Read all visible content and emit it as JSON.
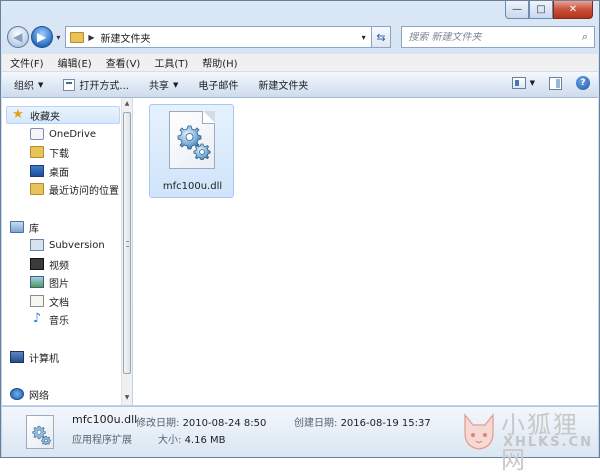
{
  "window": {
    "minimize_glyph": "—",
    "maximize_glyph": "□",
    "close_glyph": "✕"
  },
  "nav": {
    "back_glyph": "◀",
    "forward_glyph": "▶",
    "history_dd": "▾",
    "address_sep": "▶",
    "address_path": "新建文件夹",
    "address_dd": "▾",
    "refresh_glyph": "⇆",
    "search_placeholder": "搜索 新建文件夹",
    "search_glyph": "⌕"
  },
  "menubar": {
    "items": [
      "文件(F)",
      "编辑(E)",
      "查看(V)",
      "工具(T)",
      "帮助(H)"
    ]
  },
  "commandbar": {
    "organize": "组织",
    "open_with": "打开方式...",
    "share": "共享",
    "email": "电子邮件",
    "new_folder": "新建文件夹",
    "dd": "▼",
    "help": "?"
  },
  "navpane": {
    "favorites": "收藏夹",
    "onedrive": "OneDrive",
    "downloads": "下载",
    "desktop": "桌面",
    "recent": "最近访问的位置",
    "libraries": "库",
    "subversion": "Subversion",
    "videos": "视频",
    "pictures": "图片",
    "documents": "文档",
    "music": "音乐",
    "computer": "计算机",
    "network": "网络",
    "star_glyph": "★",
    "music_glyph": "♪",
    "scroll_up": "▲",
    "scroll_down": "▼"
  },
  "content": {
    "files": [
      {
        "name": "mfc100u.dll",
        "icon": "gear-icon"
      }
    ]
  },
  "details": {
    "file_name": "mfc100u.dll",
    "modified_label": "修改日期:",
    "modified_value": "2010-08-24 8:50",
    "created_label": "创建日期:",
    "created_value": "2016-08-19 15:37",
    "type": "应用程序扩展",
    "size_label": "大小:",
    "size_value": "4.16 MB"
  },
  "watermark": {
    "text_cn": "小狐狸网",
    "text_en": "XHLKS.CN"
  }
}
